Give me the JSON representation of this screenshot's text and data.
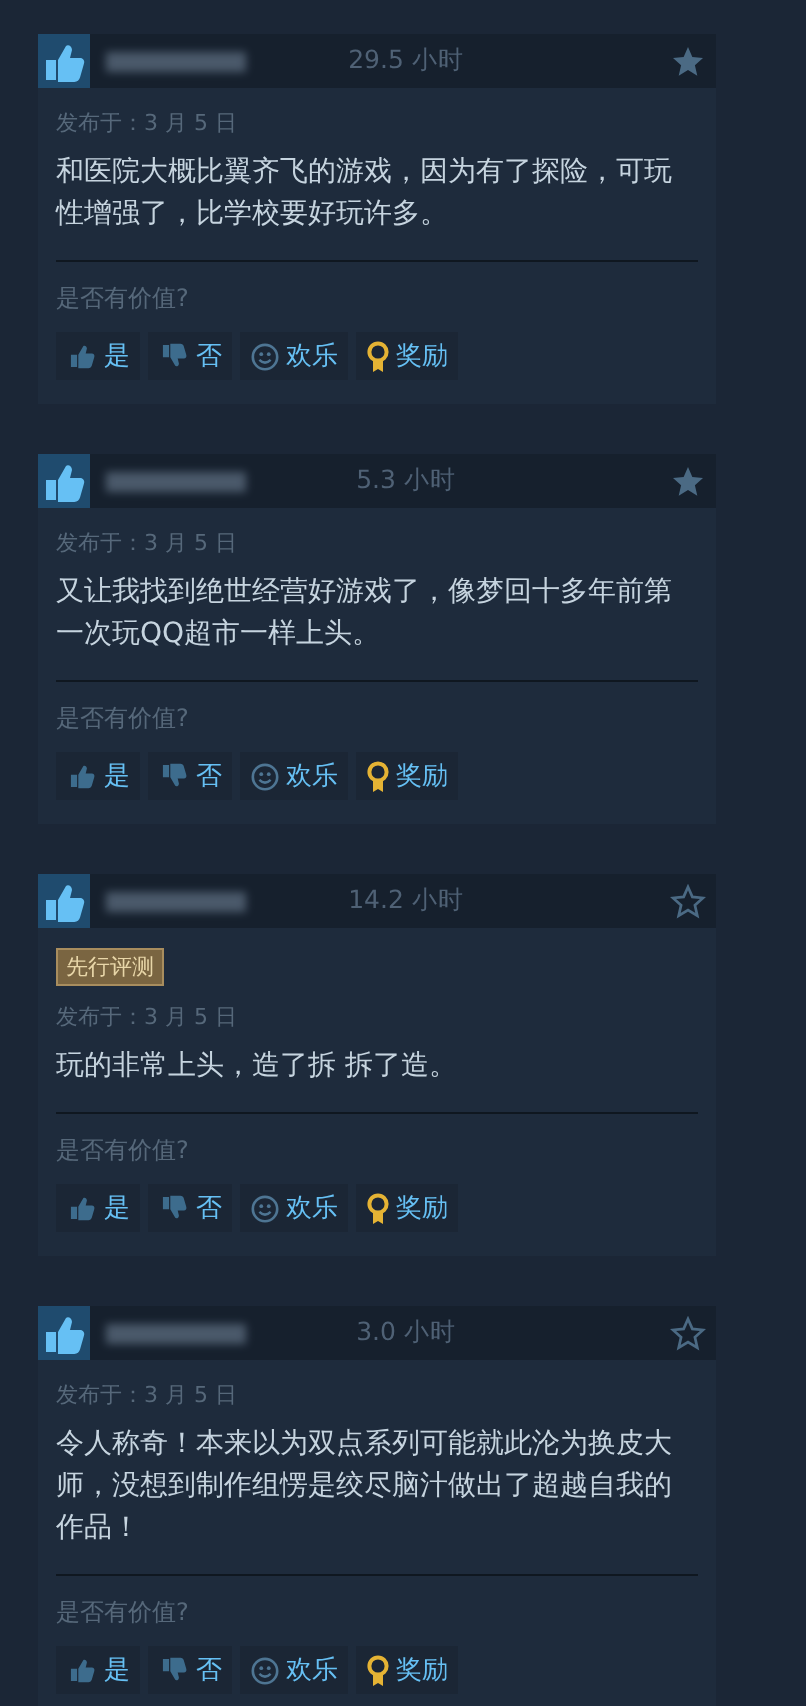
{
  "reviews": [
    {
      "recommended": true,
      "hours": "29.5 小时",
      "starred": true,
      "posted": "发布于：3 月 5 日",
      "text": "和医院大概比翼齐飞的游戏，因为有了探险，可玩性增强了，比学校要好玩许多。",
      "helpful_prompt": "是否有价值?",
      "buttons": [
        {
          "kind": "yes",
          "label": "是"
        },
        {
          "kind": "no",
          "label": "否"
        },
        {
          "kind": "funny",
          "label": "欢乐"
        },
        {
          "kind": "award",
          "label": "奖励"
        }
      ]
    },
    {
      "recommended": true,
      "hours": "5.3 小时",
      "starred": true,
      "posted": "发布于：3 月 5 日",
      "text": "又让我找到绝世经营好游戏了，像梦回十多年前第一次玩QQ超市一样上头。",
      "helpful_prompt": "是否有价值?",
      "buttons": [
        {
          "kind": "yes",
          "label": "是"
        },
        {
          "kind": "no",
          "label": "否"
        },
        {
          "kind": "funny",
          "label": "欢乐"
        },
        {
          "kind": "award",
          "label": "奖励"
        }
      ]
    },
    {
      "recommended": true,
      "hours": "14.2 小时",
      "starred": false,
      "early_access": "先行评测",
      "posted": "发布于：3 月 5 日",
      "text": "玩的非常上头，造了拆 拆了造。",
      "helpful_prompt": "是否有价值?",
      "buttons": [
        {
          "kind": "yes",
          "label": "是"
        },
        {
          "kind": "no",
          "label": "否"
        },
        {
          "kind": "funny",
          "label": "欢乐"
        },
        {
          "kind": "award",
          "label": "奖励"
        }
      ]
    },
    {
      "recommended": true,
      "hours": "3.0 小时",
      "starred": false,
      "posted": "发布于：3 月 5 日",
      "text": "令人称奇！本来以为双点系列可能就此沦为换皮大师，没想到制作组愣是绞尽脑汁做出了超越自我的作品！",
      "helpful_prompt": "是否有价值?",
      "buttons": [
        {
          "kind": "yes",
          "label": "是"
        },
        {
          "kind": "no",
          "label": "否"
        },
        {
          "kind": "funny",
          "label": "欢乐"
        },
        {
          "kind": "award",
          "label": "奖励"
        }
      ]
    }
  ]
}
